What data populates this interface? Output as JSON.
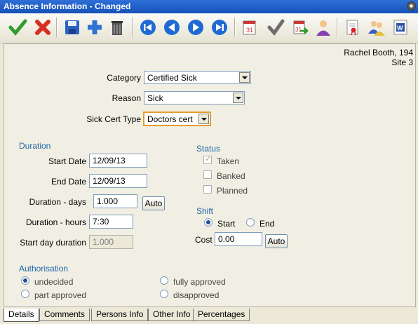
{
  "window": {
    "title": "Absence Information - Changed"
  },
  "toolbar": {
    "buttons": [
      {
        "icon": "green-check-icon"
      },
      {
        "icon": "red-x-icon"
      },
      {
        "icon": "save-disk-icon"
      },
      {
        "icon": "blue-plus-icon"
      },
      {
        "icon": "trash-bin-icon"
      },
      {
        "icon": "first-record-icon"
      },
      {
        "icon": "previous-record-icon"
      },
      {
        "icon": "next-record-icon"
      },
      {
        "icon": "last-record-icon"
      },
      {
        "icon": "calendar-icon"
      },
      {
        "icon": "gray-check-icon"
      },
      {
        "icon": "calendar-arrow-icon"
      },
      {
        "icon": "person-icon"
      },
      {
        "icon": "document-ribbon-icon"
      },
      {
        "icon": "two-people-icon"
      },
      {
        "icon": "word-document-icon"
      }
    ]
  },
  "employee": {
    "name": "Rachel Booth, 194",
    "site": "Site 3"
  },
  "category": {
    "label": "Category",
    "value": "Certified Sick"
  },
  "reason": {
    "label": "Reason",
    "value": "Sick"
  },
  "sick_cert": {
    "label": "Sick Cert Type",
    "value": "Doctors cert"
  },
  "duration": {
    "heading": "Duration",
    "start_label": "Start Date",
    "start_value": "12/09/13",
    "end_label": "End Date",
    "end_value": "12/09/13",
    "days_label": "Duration - days",
    "days_value": "1.000",
    "auto_label": "Auto",
    "hours_label": "Duration - hours",
    "hours_value": "7:30",
    "start_day_label": "Start day duration",
    "start_day_value": "1.000"
  },
  "status": {
    "heading": "Status",
    "taken": "Taken",
    "banked": "Banked",
    "planned": "Planned"
  },
  "shift": {
    "heading": "Shift",
    "start": "Start",
    "end": "End",
    "cost_label": "Cost",
    "cost_value": "0.00",
    "auto_label": "Auto"
  },
  "authorisation": {
    "heading": "Authorisation",
    "undecided": "undecided",
    "part_approved": "part approved",
    "fully_approved": "fully approved",
    "disapproved": "disapproved"
  },
  "tabs": [
    "Details",
    "Comments",
    "Persons Info",
    "Other Info",
    "Percentages"
  ]
}
